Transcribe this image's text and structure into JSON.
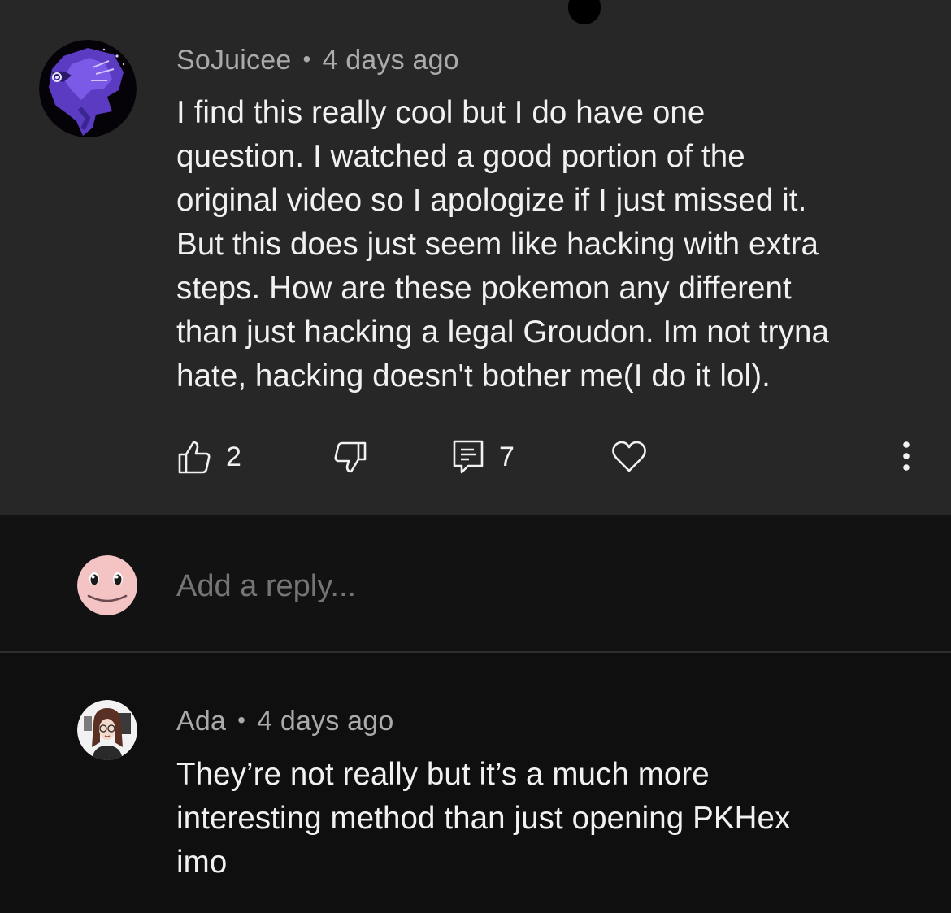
{
  "comment": {
    "author": "SoJuicee",
    "separator": "•",
    "time": "4 days ago",
    "lines": [
      "I find this really cool but I do have one",
      "question. I watched a good portion of the",
      "original video so I apologize if I just missed it.",
      "But this does just seem like hacking with extra",
      "steps. How are these pokemon any different",
      "than just hacking a legal Groudon. Im not tryna",
      "hate, hacking doesn't bother me(I do it lol)."
    ],
    "like_count": "2",
    "reply_count": "7"
  },
  "reply_box": {
    "placeholder": "Add a reply..."
  },
  "reply": {
    "author": "Ada",
    "separator": "•",
    "time": "4 days ago",
    "lines": [
      "They’re not really but it’s a much more",
      "interesting method than just opening PKHex",
      "imo"
    ]
  },
  "icons": {
    "like": "thumbs-up-icon",
    "dislike": "thumbs-down-icon",
    "replies": "comment-icon",
    "heart": "heart-icon",
    "more": "more-vertical-icon"
  },
  "colors": {
    "comment_bg": "#272727",
    "page_bg": "#0f0f0f",
    "text_primary": "#f1f1f1",
    "text_secondary": "#aaaaaa",
    "avatar_accent": "#6a4bd8"
  }
}
